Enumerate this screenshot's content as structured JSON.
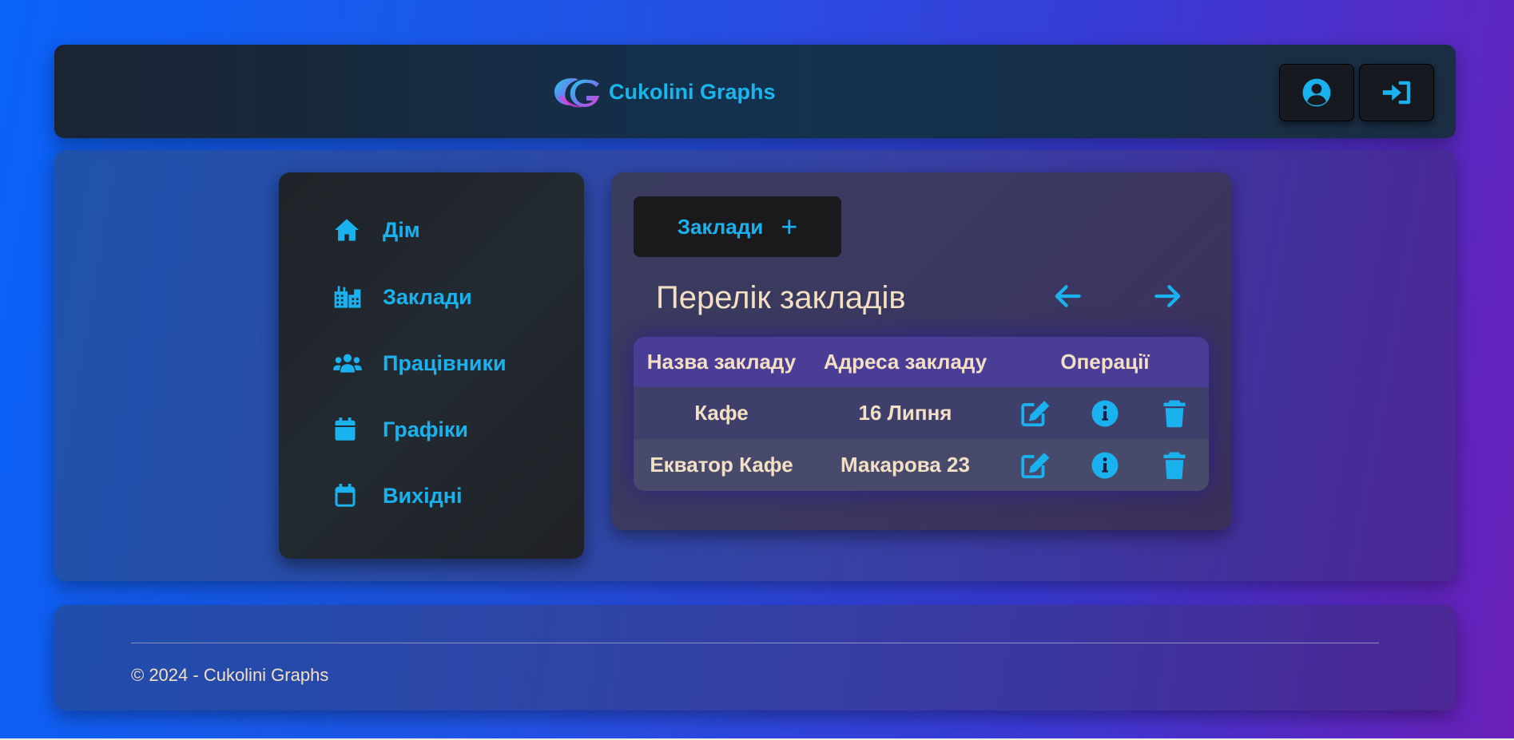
{
  "header": {
    "brand_name": "Cukolini Graphs",
    "logo_icon": "cg-logo-icon",
    "profile_icon": "user-circle-icon",
    "login_icon": "sign-in-icon"
  },
  "sidebar": {
    "items": [
      {
        "label": "Дім",
        "icon": "home-icon"
      },
      {
        "label": "Заклади",
        "icon": "city-icon"
      },
      {
        "label": "Працівники",
        "icon": "users-icon"
      },
      {
        "label": "Графіки",
        "icon": "calendar-icon"
      },
      {
        "label": "Вихідні",
        "icon": "calendar-outline-icon"
      }
    ]
  },
  "panel": {
    "add_button_label": "Заклади",
    "add_button_plus": "+",
    "title": "Перелік закладів",
    "table": {
      "headers": [
        "Назва закладу",
        "Адреса закладу",
        "Операції"
      ],
      "rows": [
        {
          "name": "Кафе",
          "address": "16 Липня"
        },
        {
          "name": "Екватор Кафе",
          "address": "Макарова 23"
        }
      ]
    }
  },
  "footer": {
    "copyright": "© 2024 - Cukolini Graphs"
  },
  "colors": {
    "accent": "#1ab2ee",
    "text_warm": "#f3dfc3",
    "table_header": "#4a3d96"
  }
}
